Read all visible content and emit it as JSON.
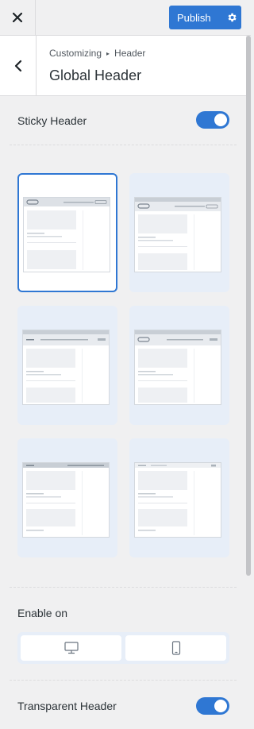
{
  "topbar": {
    "close_icon": "close-icon",
    "publish_label": "Publish",
    "settings_icon": "gear-icon",
    "accent": "#2f77d3"
  },
  "section": {
    "back_icon": "chevron-left-icon",
    "breadcrumb_parent": "Customizing",
    "breadcrumb_separator": "▸",
    "breadcrumb_current": "Header",
    "title": "Global Header"
  },
  "sticky_header": {
    "label": "Sticky Header",
    "enabled": true
  },
  "layouts": {
    "count": 6,
    "selected_index": 0
  },
  "enable_on": {
    "label": "Enable on",
    "options": [
      "desktop-icon",
      "mobile-icon"
    ]
  },
  "transparent_header": {
    "label": "Transparent Header",
    "enabled": true
  }
}
